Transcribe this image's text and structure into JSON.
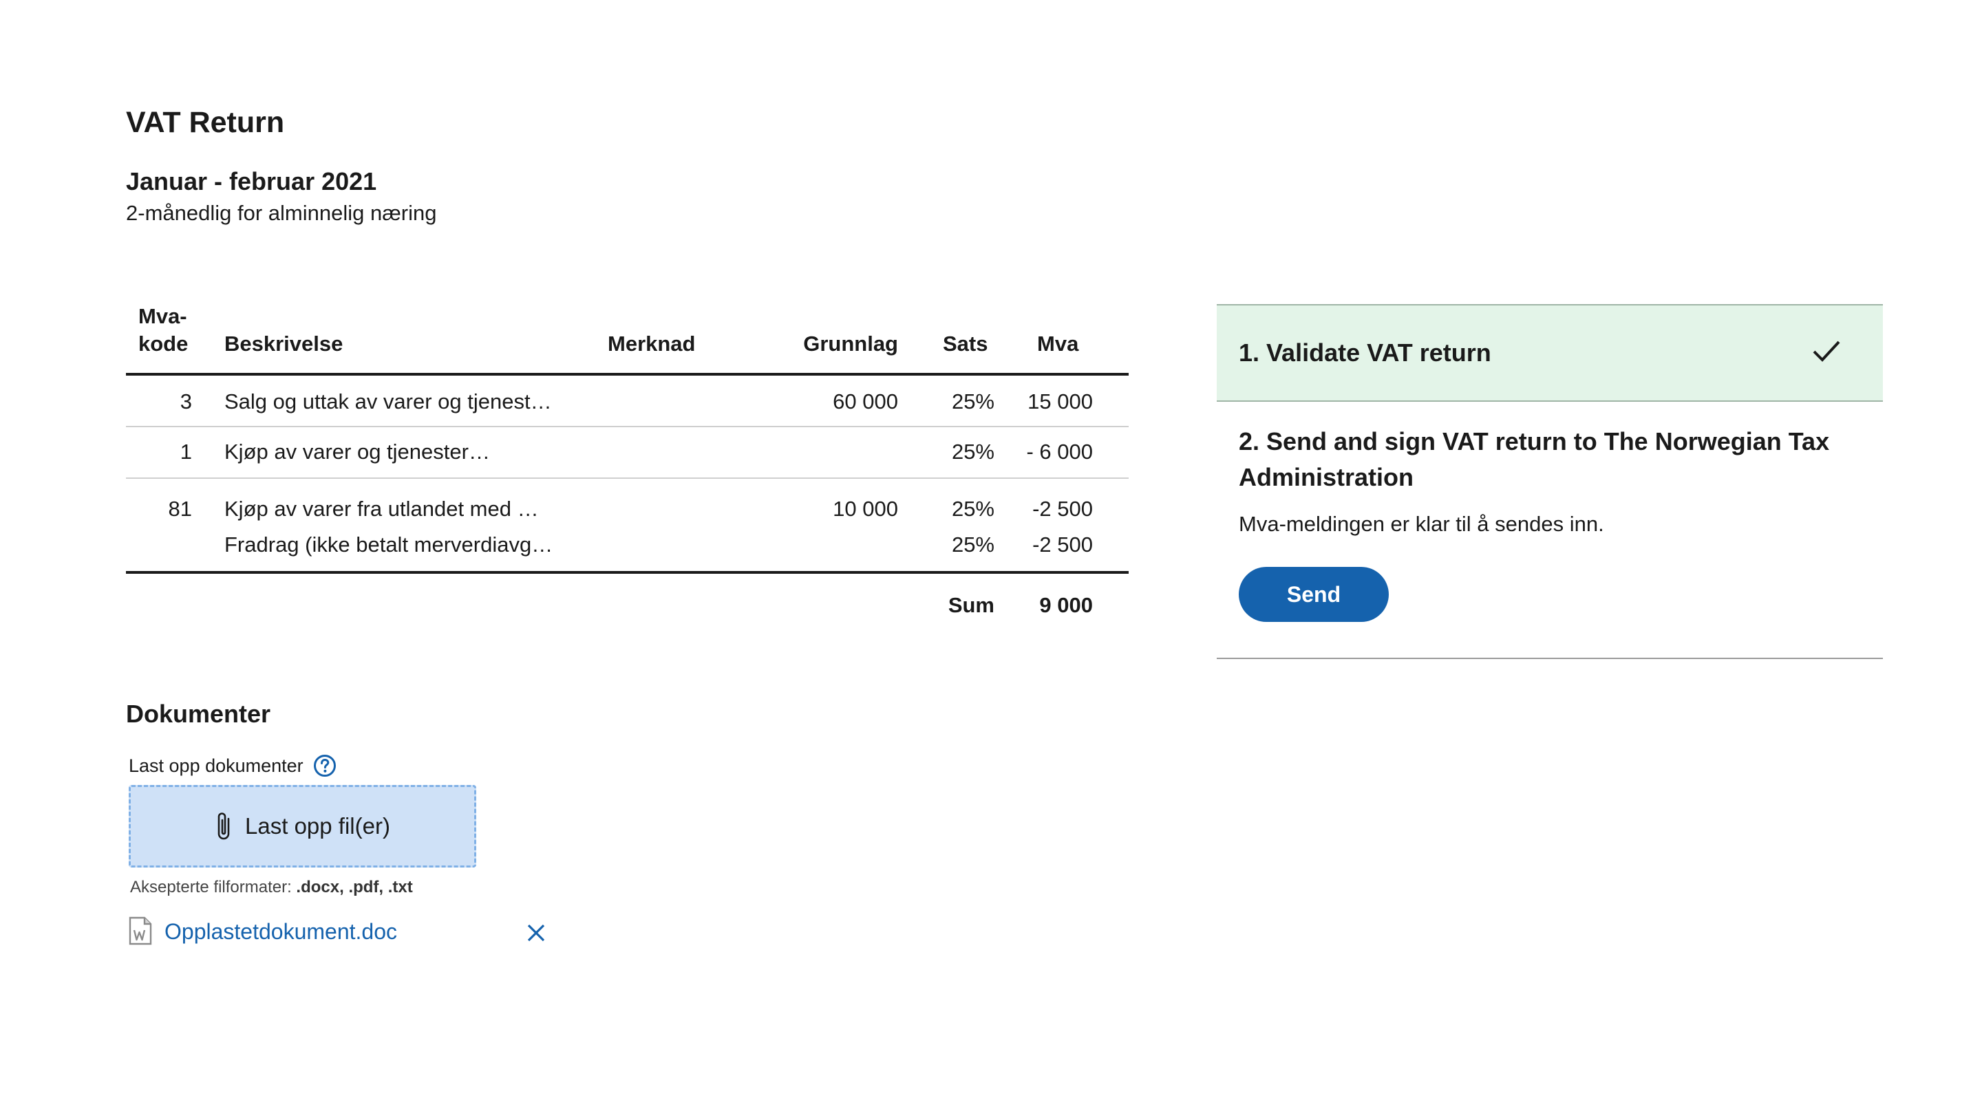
{
  "page": {
    "title": "VAT Return",
    "period": "Januar - februar 2021",
    "period_description": "2-månedlig for alminnelig næring"
  },
  "vat_table": {
    "headers": {
      "code_line1": "Mva-",
      "code_line2": "kode",
      "description": "Beskrivelse",
      "note": "Merknad",
      "basis": "Grunnlag",
      "rate": "Sats",
      "vat": "Mva"
    },
    "rows": [
      {
        "code": "3",
        "description": "Salg og uttak av varer og tjenest…",
        "note": "",
        "basis": "60 000",
        "rate": "25%",
        "vat": "15 000"
      },
      {
        "code": "1",
        "description": "Kjøp av varer og tjenester…",
        "note": "",
        "basis": "",
        "rate": "25%",
        "vat": "- 6 000"
      },
      {
        "code": "81",
        "description": "Kjøp av varer fra utlandet med …",
        "note": "",
        "basis": "10 000",
        "rate": "25%",
        "vat": "-2 500",
        "sub": {
          "description": "Fradrag (ikke betalt merverdiavg…",
          "rate": "25%",
          "vat": "-2 500"
        }
      }
    ],
    "sum_label": "Sum",
    "sum_value": "9 000"
  },
  "steps": {
    "step1": {
      "title": "1. Validate VAT return",
      "status_icon": "check-icon",
      "status_color": "#1a1a1a",
      "background": "#e3f4e8"
    },
    "step2": {
      "title": "2. Send and sign VAT return to The Norwegian Tax Administration",
      "description": "Mva-meldingen er klar til å sendes inn.",
      "button_label": "Send",
      "button_color": "#1562ad"
    }
  },
  "documents": {
    "title": "Dokumenter",
    "upload_label": "Last opp dokumenter",
    "help_icon": "question-circle-icon",
    "dropzone_label": "Last opp fil(er)",
    "dropzone_icon": "paperclip-icon",
    "formats_label": "Aksepterte filformater:",
    "formats_value": ".docx, .pdf, .txt",
    "files": [
      {
        "name": "Opplastetdokument.doc",
        "icon": "word-file-icon",
        "remove_icon": "close-icon"
      }
    ]
  },
  "colors": {
    "accent": "#1562ad",
    "success_bg": "#e3f4e8",
    "dropzone_bg": "#cfe1f7",
    "dropzone_border": "#7fb0e6"
  }
}
